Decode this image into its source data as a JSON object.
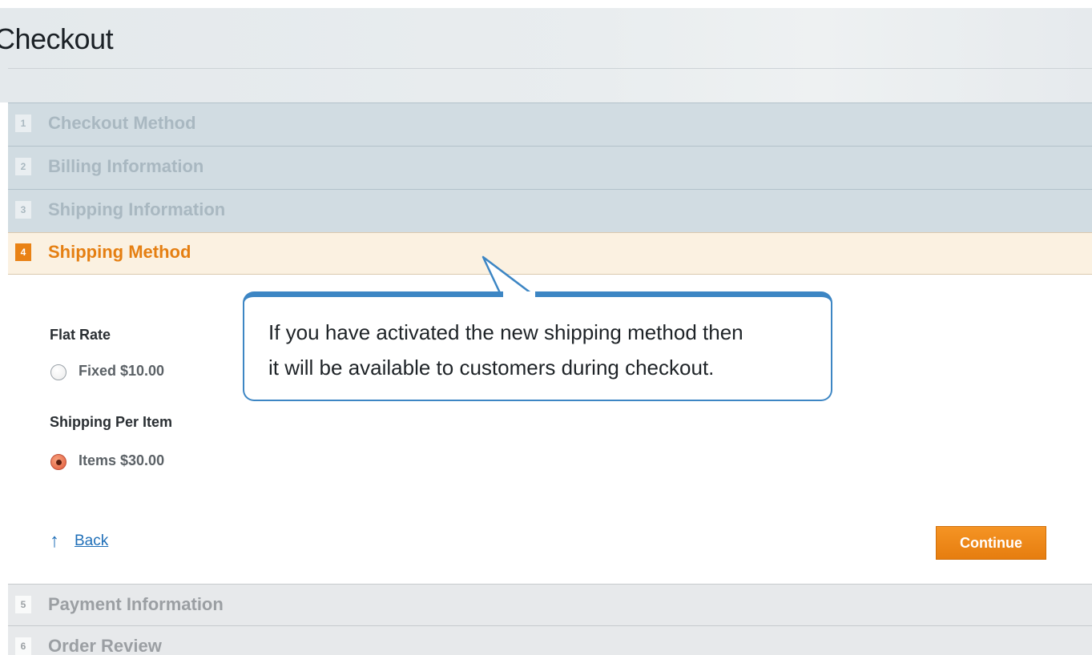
{
  "page": {
    "title": "Checkout"
  },
  "steps": [
    {
      "number": "1",
      "title": "Checkout Method"
    },
    {
      "number": "2",
      "title": "Billing Information"
    },
    {
      "number": "3",
      "title": "Shipping Information"
    },
    {
      "number": "4",
      "title": "Shipping Method"
    },
    {
      "number": "5",
      "title": "Payment Information"
    },
    {
      "number": "6",
      "title": "Order Review"
    }
  ],
  "shipping_method": {
    "groups": [
      {
        "title": "Flat Rate",
        "option_label": "Fixed $10.00",
        "selected": false
      },
      {
        "title": "Shipping Per Item",
        "option_label": "Items $30.00",
        "selected": true
      }
    ],
    "back_label": "Back",
    "back_icon": "arrow-up-icon",
    "continue_label": "Continue"
  },
  "callout": {
    "line1": "If you have activated the new shipping method then",
    "line2": "it will be available to customers during checkout."
  },
  "colors": {
    "accent": "#e98215",
    "link": "#1f6fb8",
    "callout_border": "#3d86c4",
    "inactive_step_bg": "#d1dce2",
    "active_step_bg": "#fbf1e1"
  }
}
